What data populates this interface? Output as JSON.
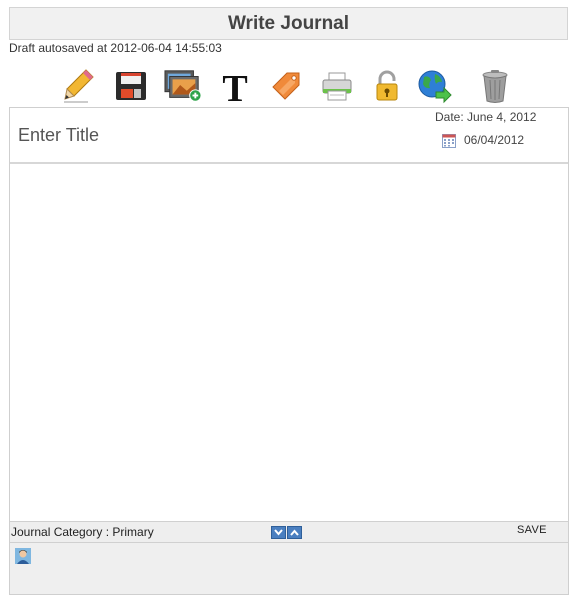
{
  "header": {
    "title": "Write Journal"
  },
  "status": {
    "autosave_text": "Draft autosaved at 2012-06-04 14:55:03"
  },
  "toolbar": {
    "tools": [
      {
        "name": "edit",
        "icon": "pencil-icon"
      },
      {
        "name": "save",
        "icon": "floppy-disk-icon"
      },
      {
        "name": "insert-image",
        "icon": "add-image-icon"
      },
      {
        "name": "text-format",
        "icon": "text-t-icon"
      },
      {
        "name": "tag",
        "icon": "tag-icon"
      },
      {
        "name": "print",
        "icon": "printer-icon"
      },
      {
        "name": "privacy",
        "icon": "padlock-icon"
      },
      {
        "name": "share",
        "icon": "globe-arrow-icon"
      },
      {
        "name": "delete",
        "icon": "trash-can-icon"
      }
    ]
  },
  "entry": {
    "title_placeholder": "Enter Title",
    "title_value": "",
    "date_label": "Date: June 4, 2012",
    "date_value": "06/04/2012",
    "body_value": ""
  },
  "footer": {
    "category_text": "Journal Category : Primary",
    "save_label": "SAVE"
  },
  "colors": {
    "header_bg": "#f1f1f1",
    "footer_bg": "#eeeeee",
    "arrow_blue": "#4a7fc0"
  }
}
